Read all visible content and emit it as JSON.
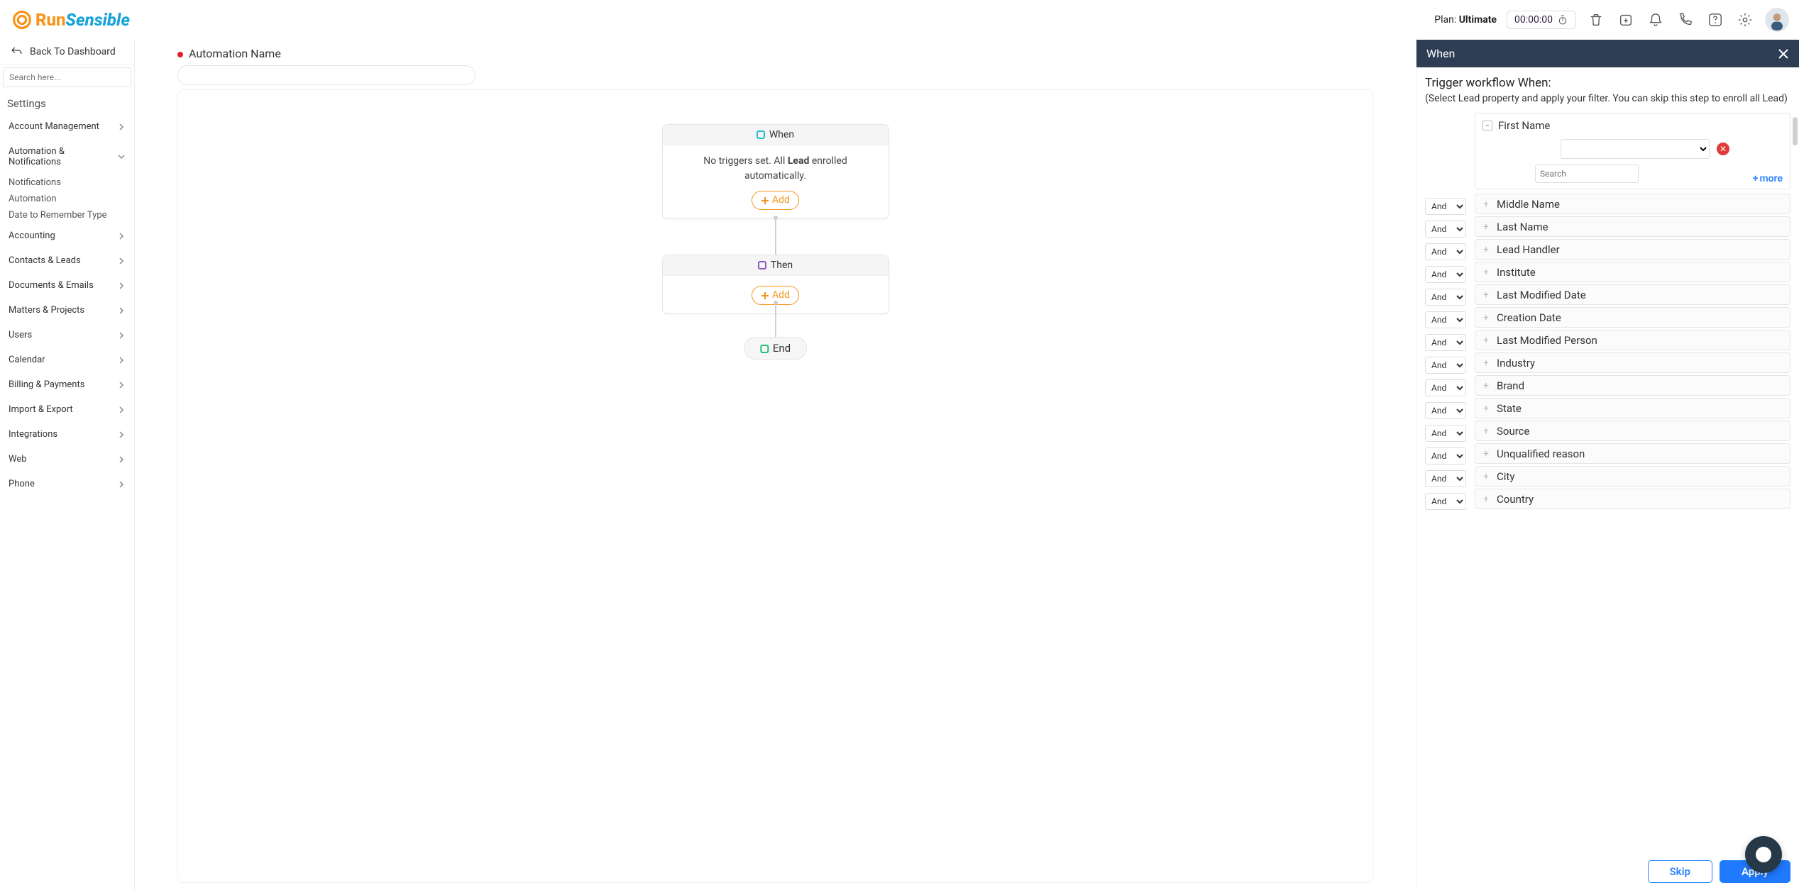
{
  "brand": {
    "a": "Run",
    "b": "Sensible"
  },
  "topbar": {
    "plan_prefix": "Plan:",
    "plan_name": "Ultimate",
    "timer": "00:00:00"
  },
  "sidebar": {
    "back_label": "Back To Dashboard",
    "search_placeholder": "Search here...",
    "heading": "Settings",
    "items": [
      {
        "label": "Account Management",
        "expanded": false
      },
      {
        "label": "Automation & Notifications",
        "expanded": true,
        "children": [
          {
            "label": "Notifications"
          },
          {
            "label": "Automation"
          },
          {
            "label": "Date to Remember Type"
          }
        ]
      },
      {
        "label": "Accounting"
      },
      {
        "label": "Contacts & Leads"
      },
      {
        "label": "Documents & Emails"
      },
      {
        "label": "Matters & Projects"
      },
      {
        "label": "Users"
      },
      {
        "label": "Calendar"
      },
      {
        "label": "Billing & Payments"
      },
      {
        "label": "Import & Export"
      },
      {
        "label": "Integrations"
      },
      {
        "label": "Web"
      },
      {
        "label": "Phone"
      }
    ]
  },
  "canvas": {
    "name_label": "Automation Name",
    "when": {
      "head": "When",
      "body_prefix": "No triggers set. All ",
      "body_bold": "Lead",
      "body_suffix": " enrolled automatically.",
      "add_label": "Add"
    },
    "then": {
      "head": "Then",
      "add_label": "Add"
    },
    "end": {
      "label": "End"
    }
  },
  "panel": {
    "head": "When",
    "title": "Trigger workflow When:",
    "subtitle": "(Select Lead property and apply your filter. You can skip this step to enroll all Lead)",
    "first_property": "First Name",
    "search_placeholder": "Search",
    "more_label": "more",
    "and_option": "And",
    "properties": [
      "Middle Name",
      "Last Name",
      "Lead Handler",
      "Institute",
      "Last Modified Date",
      "Creation Date",
      "Last Modified Person",
      "Industry",
      "Brand",
      "State",
      "Source",
      "Unqualified reason",
      "City",
      "Country"
    ],
    "footer": {
      "skip": "Skip",
      "apply": "Apply"
    }
  }
}
